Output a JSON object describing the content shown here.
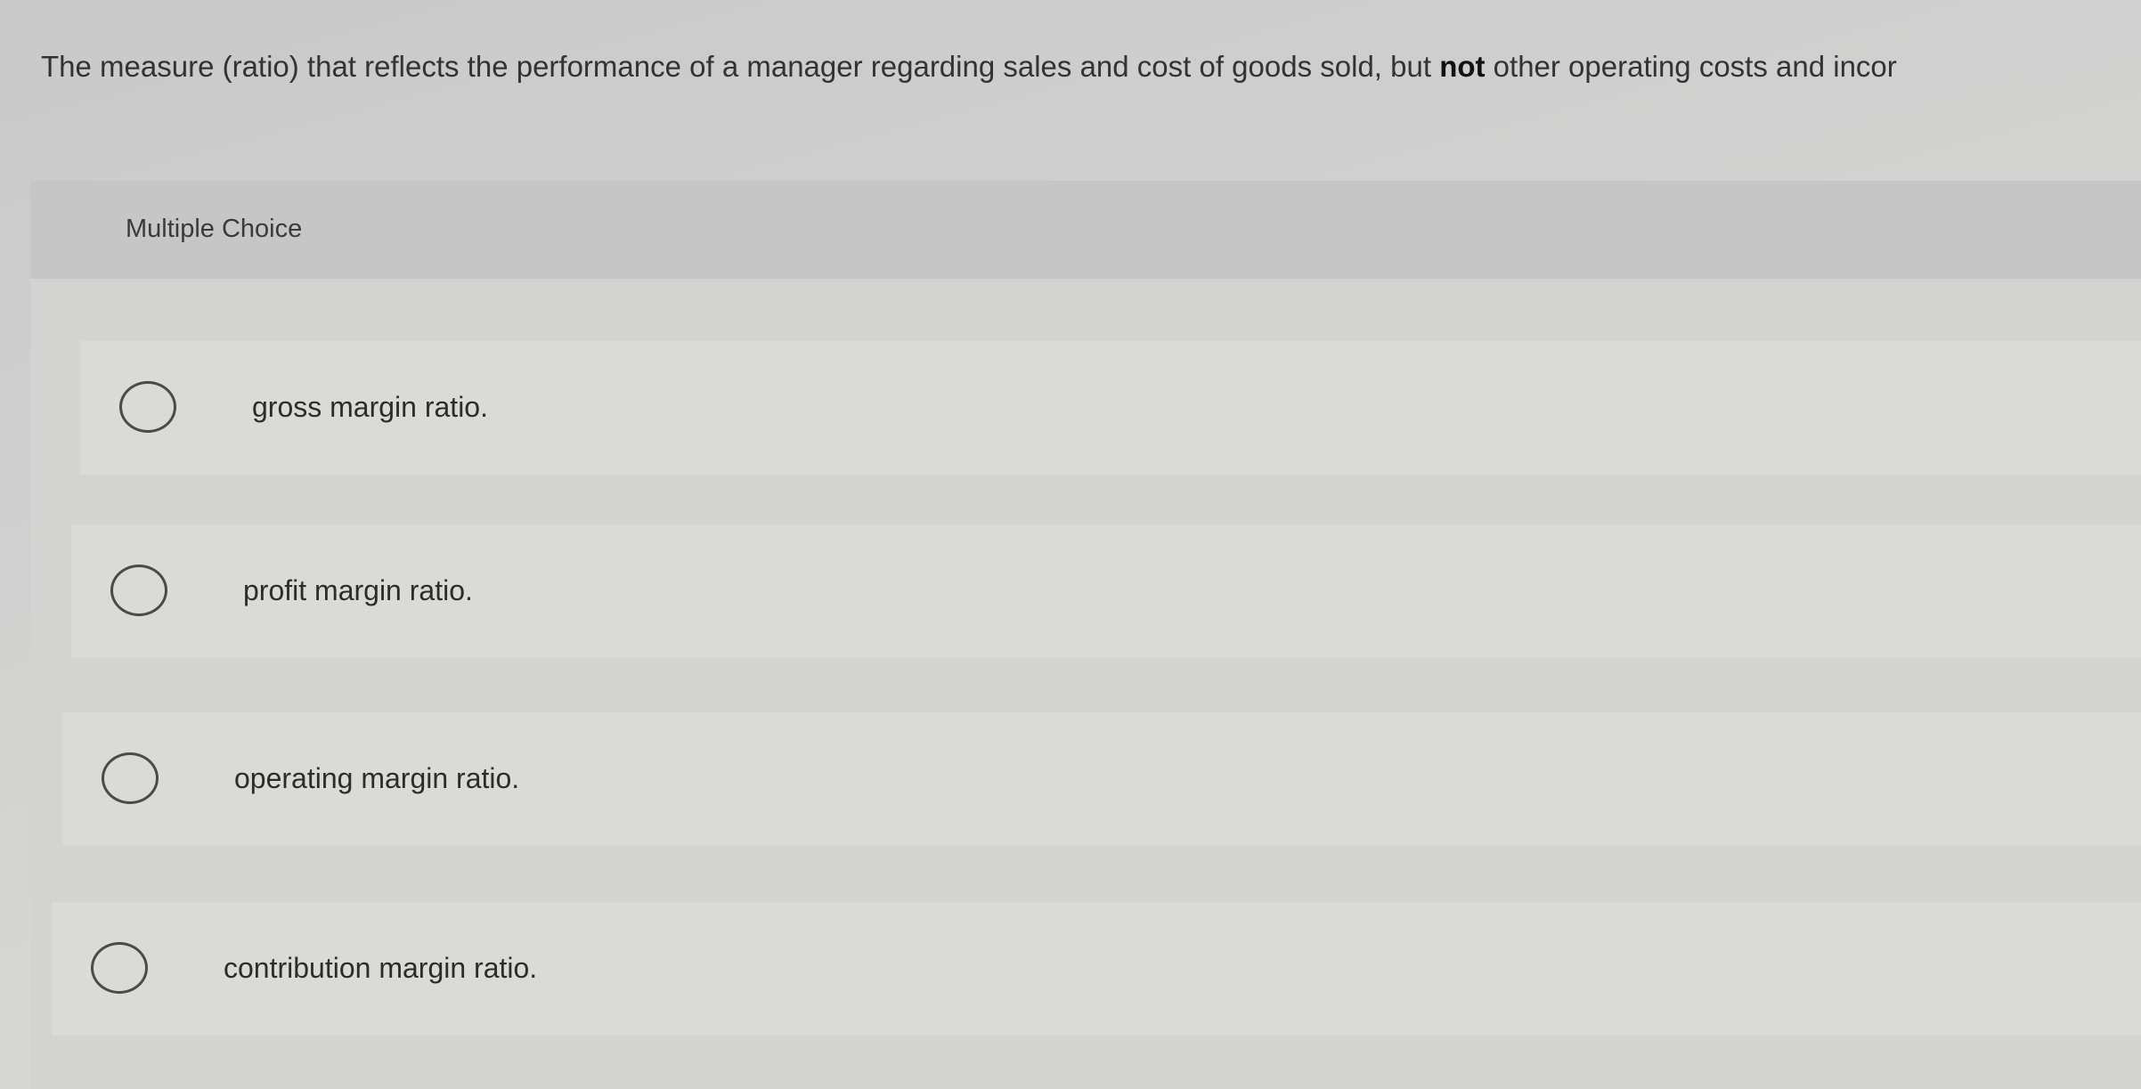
{
  "question": {
    "text_before": "The measure (ratio) that reflects the performance of a manager regarding sales and cost of goods sold, but ",
    "emphasis": "not",
    "text_after": " other operating costs and incor"
  },
  "choice_header": "Multiple Choice",
  "options": [
    {
      "label": "gross margin ratio.",
      "selected": false
    },
    {
      "label": "profit margin ratio.",
      "selected": false
    },
    {
      "label": "operating margin ratio.",
      "selected": false
    },
    {
      "label": "contribution margin ratio.",
      "selected": false
    }
  ],
  "colors": {
    "background": "#cfcfcf",
    "header": "#c6c6c6",
    "option_bg": "#dadad6",
    "radio_border": "#4a4a4a",
    "text": "#2c2c2c"
  }
}
